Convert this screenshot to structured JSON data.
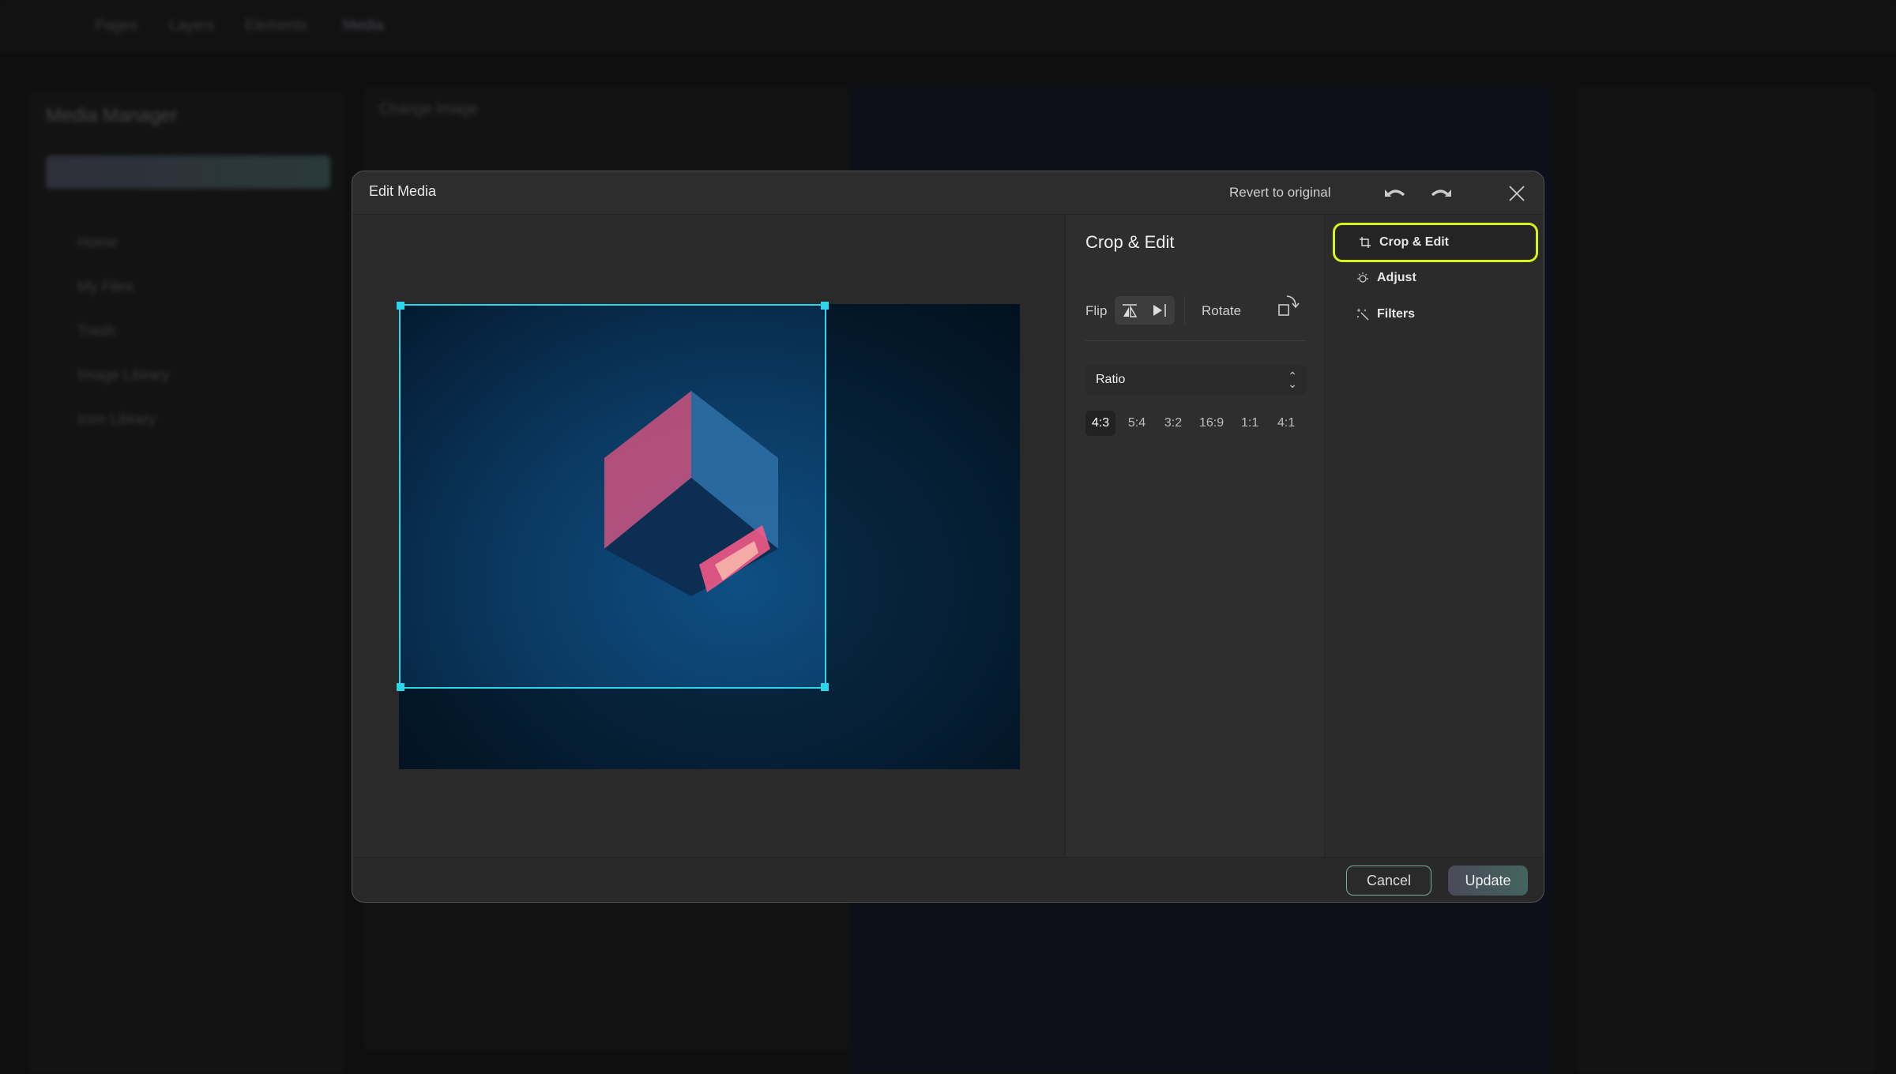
{
  "background": {
    "nav": [
      "Pages",
      "Layers",
      "Elements",
      "Media"
    ],
    "media_manager": "Media Manager",
    "sidebar": [
      "Home",
      "My Files",
      "Trash",
      "Image Library",
      "Icon Library"
    ],
    "change_image": "Change Image"
  },
  "modal": {
    "title": "Edit Media",
    "revert_label": "Revert to original"
  },
  "crop_panel": {
    "heading": "Crop & Edit",
    "flip_label": "Flip",
    "rotate_label": "Rotate",
    "ratio_label": "Ratio",
    "ratios": [
      "4:3",
      "5:4",
      "3:2",
      "16:9",
      "1:1",
      "4:1"
    ],
    "selected_ratio": "4:3"
  },
  "tools": [
    {
      "label": "Crop & Edit",
      "icon": "crop-icon",
      "active": true
    },
    {
      "label": "Adjust",
      "icon": "sun-icon"
    },
    {
      "label": "Filters",
      "icon": "magic-wand-icon"
    }
  ],
  "footer": {
    "cancel_label": "Cancel",
    "update_label": "Update"
  },
  "colors": {
    "accent_highlight": "#d8f21c",
    "crop_border": "#2ad6e8"
  }
}
